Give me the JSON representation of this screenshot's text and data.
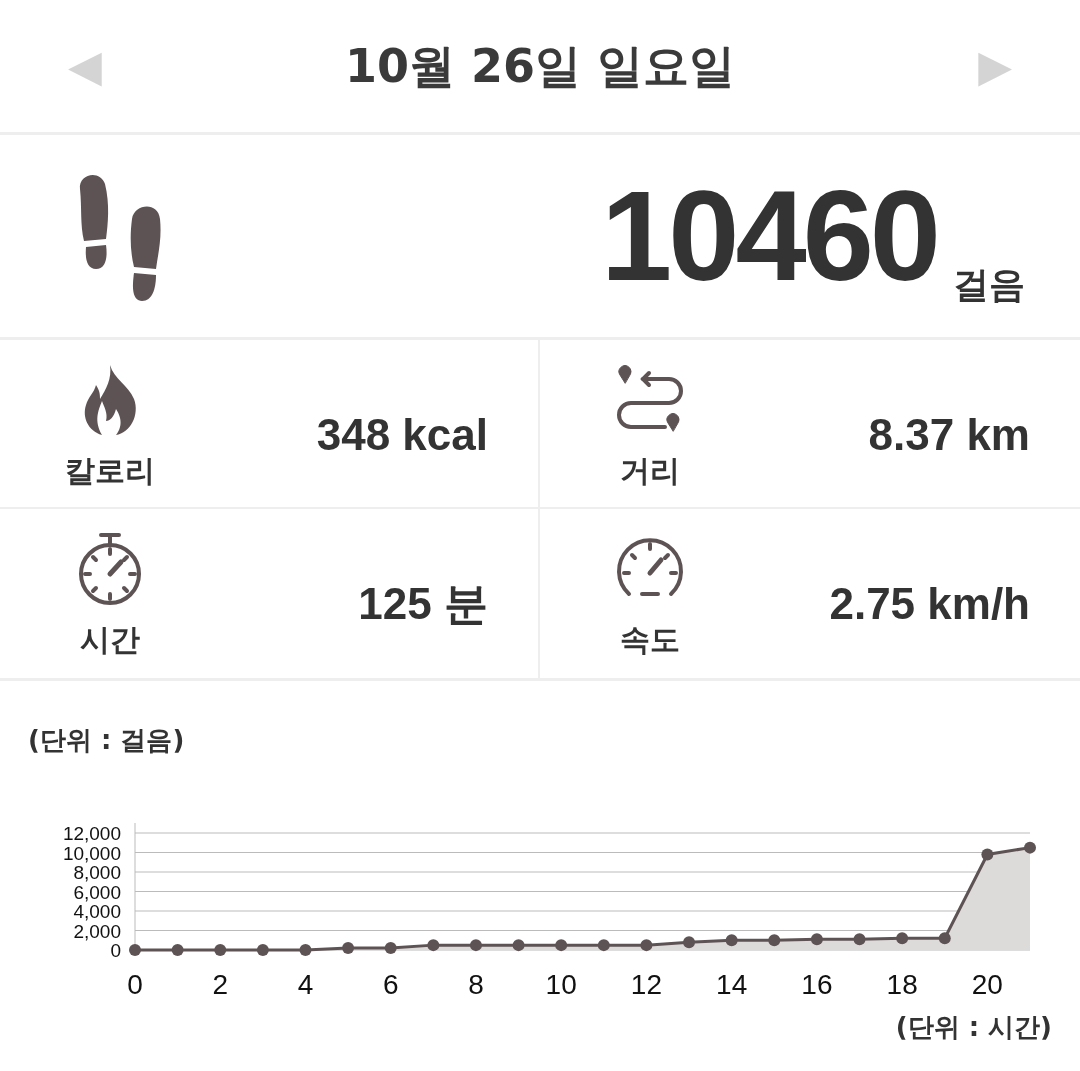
{
  "header": {
    "prev_label": "◀",
    "date": "10월 26일 일요일",
    "next_label": "▶"
  },
  "steps": {
    "value": "10460",
    "unit": "걸음"
  },
  "stats": [
    {
      "kind": "calories",
      "label": "칼로리",
      "value": "348 kcal"
    },
    {
      "kind": "distance",
      "label": "거리",
      "value": "8.37 km"
    },
    {
      "kind": "time",
      "label": "시간",
      "value": "125 분"
    },
    {
      "kind": "speed",
      "label": "속도",
      "value": "2.75 km/h"
    }
  ],
  "chart": {
    "unit_label": "(단위 : 걸음)",
    "x_unit_label": "(단위 : 시간)",
    "chart_data": {
      "type": "area",
      "x": [
        0,
        1,
        2,
        3,
        4,
        5,
        6,
        7,
        8,
        9,
        10,
        11,
        12,
        13,
        14,
        15,
        16,
        17,
        18,
        19,
        20,
        21
      ],
      "series": [
        {
          "color": "#5e5354",
          "values": [
            0,
            0,
            0,
            0,
            0,
            200,
            200,
            500,
            500,
            500,
            500,
            500,
            500,
            800,
            1000,
            1000,
            1100,
            1100,
            1200,
            1200,
            9800,
            10500
          ]
        }
      ],
      "grid": true,
      "xlim": [
        0,
        21
      ],
      "ylim": [
        0,
        12000
      ],
      "xticks": [
        0,
        2,
        4,
        6,
        8,
        10,
        12,
        14,
        16,
        18,
        20
      ],
      "yticks": [
        {
          "value": 0,
          "label": "0"
        },
        {
          "value": 2000,
          "label": "2,000"
        },
        {
          "value": 4000,
          "label": "4,000"
        },
        {
          "value": 6000,
          "label": "6,000"
        },
        {
          "value": 8000,
          "label": "8,000"
        },
        {
          "value": 10000,
          "label": "10,000"
        },
        {
          "value": 12000,
          "label": "12,000"
        }
      ]
    }
  }
}
